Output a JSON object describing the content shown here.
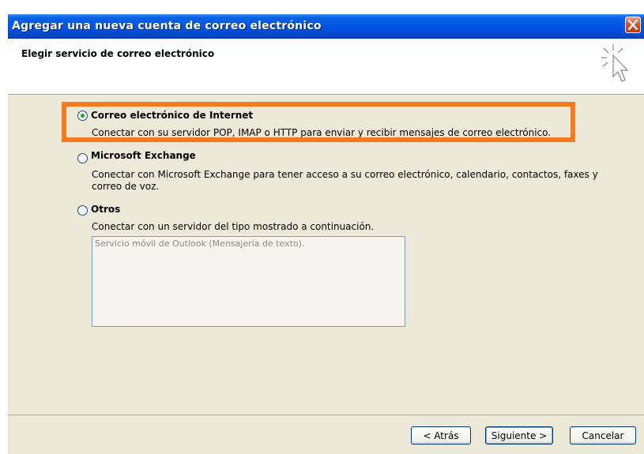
{
  "window": {
    "title": "Agregar una nueva cuenta de correo electrónico",
    "close_icon": "close-icon"
  },
  "header": {
    "title": "Elegir servicio de correo electrónico",
    "icon": "wizard-cursor-icon"
  },
  "options": [
    {
      "label": "Correo electrónico de Internet",
      "description": "Conectar con su servidor POP, IMAP o HTTP para enviar y recibir mensajes de correo electrónico.",
      "selected": true
    },
    {
      "label": "Microsoft Exchange",
      "description": "Conectar con Microsoft Exchange para tener acceso a su correo electrónico, calendario, contactos, faxes y correo de voz.",
      "selected": false
    },
    {
      "label": "Otros",
      "description": "Conectar con un servidor del tipo mostrado a continuación.",
      "selected": false
    }
  ],
  "other_servers": {
    "items": [
      "Servicio móvil de Outlook (Mensajería de texto)."
    ]
  },
  "buttons": {
    "back": "< Atrás",
    "next": "Siguiente >",
    "cancel": "Cancelar"
  },
  "colors": {
    "highlight": "#f47b20",
    "titlebar": "#0054e3",
    "dialog_bg": "#ece9d8"
  }
}
